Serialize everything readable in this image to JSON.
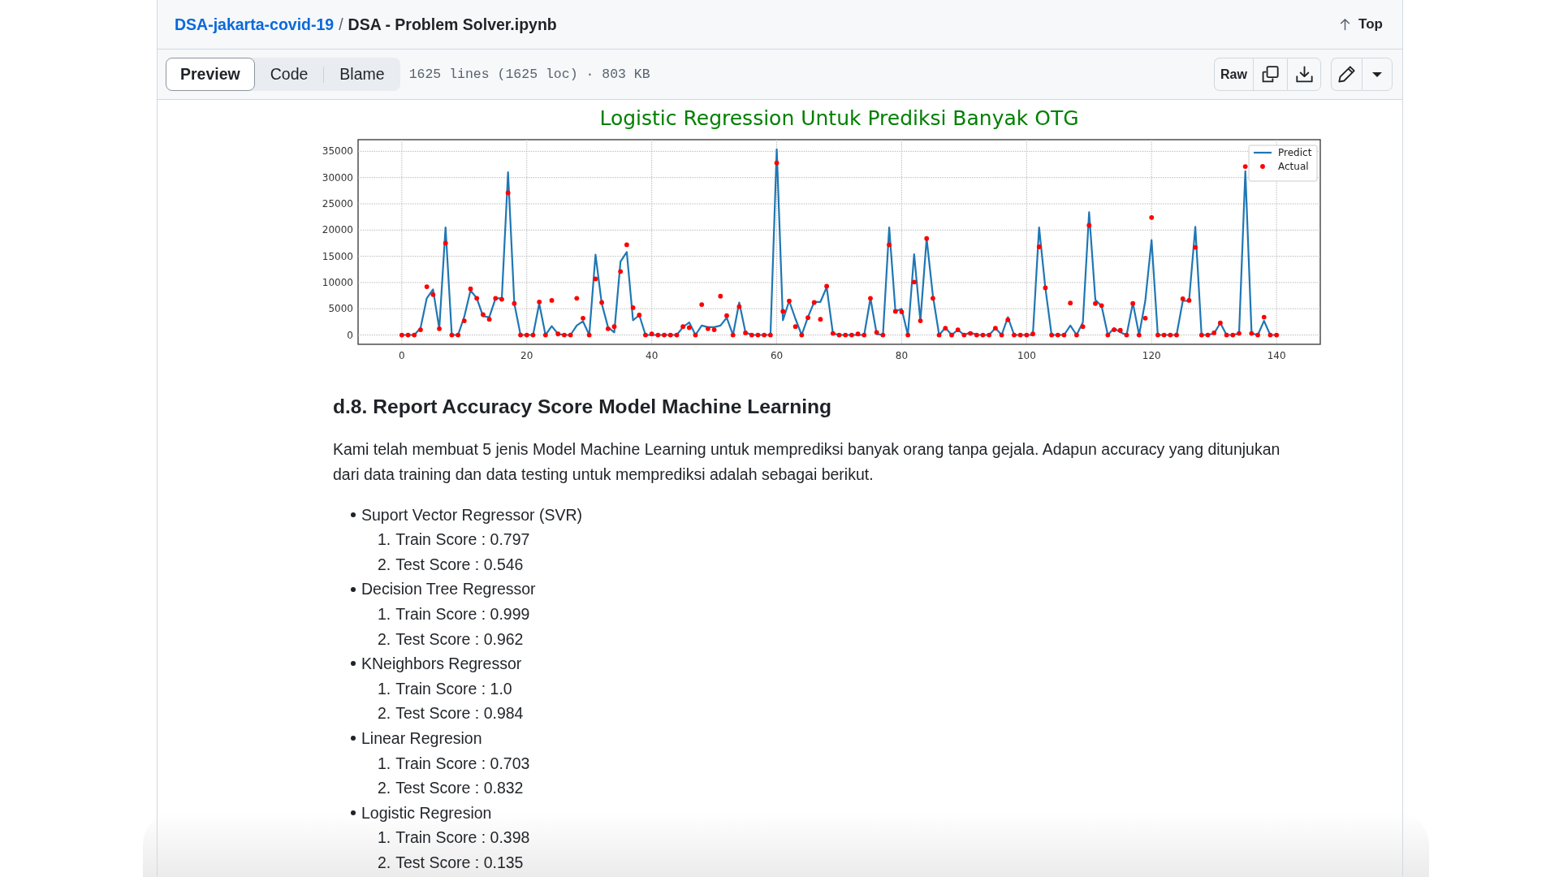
{
  "header": {
    "repo_link": "DSA-jakarta-covid-19",
    "separator": "/",
    "file_name": "DSA - Problem Solver.ipynb",
    "top_link": "Top"
  },
  "toolbar": {
    "tabs": [
      {
        "label": "Preview",
        "selected": true
      },
      {
        "label": "Code",
        "selected": false
      },
      {
        "label": "Blame",
        "selected": false
      }
    ],
    "file_info": "1625 lines (1625 loc) · 803 KB",
    "raw_button": "Raw"
  },
  "chart": {
    "chart_data": {
      "type": "line",
      "title": "Logistic Regression Untuk Prediksi Banyak OTG",
      "x": [
        0,
        1,
        2,
        3,
        4,
        5,
        6,
        7,
        8,
        9,
        10,
        11,
        12,
        13,
        14,
        15,
        16,
        17,
        18,
        19,
        20,
        21,
        22,
        23,
        24,
        25,
        26,
        27,
        28,
        29,
        30,
        31,
        32,
        33,
        34,
        35,
        36,
        37,
        38,
        39,
        40,
        41,
        42,
        43,
        44,
        45,
        46,
        47,
        48,
        49,
        50,
        51,
        52,
        53,
        54,
        55,
        56,
        57,
        58,
        59,
        60,
        61,
        62,
        63,
        64,
        65,
        66,
        67,
        68,
        69,
        70,
        71,
        72,
        73,
        74,
        75,
        76,
        77,
        78,
        79,
        80,
        81,
        82,
        83,
        84,
        85,
        86,
        87,
        88,
        89,
        90,
        91,
        92,
        93,
        94,
        95,
        96,
        97,
        98,
        99,
        100,
        101,
        102,
        103,
        104,
        105,
        106,
        107,
        108,
        109,
        110,
        111,
        112,
        113,
        114,
        115,
        116,
        117,
        118,
        119,
        120,
        121,
        122,
        123,
        124,
        125,
        126,
        127,
        128,
        129,
        130,
        131,
        132,
        133,
        134,
        135,
        136,
        137,
        138,
        139,
        140
      ],
      "series": [
        {
          "name": "Predict",
          "type": "line",
          "color": "#1f77b4",
          "values": [
            0,
            0,
            0,
            1300,
            7000,
            8700,
            1200,
            20500,
            0,
            0,
            3500,
            8500,
            7000,
            3600,
            3400,
            7000,
            7000,
            31000,
            6000,
            0,
            0,
            0,
            6000,
            0,
            1700,
            200,
            0,
            0,
            1800,
            2600,
            0,
            15300,
            6000,
            1500,
            500,
            14000,
            15800,
            2800,
            3800,
            0,
            0,
            0,
            0,
            0,
            0,
            1500,
            2400,
            0,
            1800,
            1500,
            1500,
            1800,
            3300,
            0,
            6200,
            500,
            0,
            0,
            0,
            0,
            35400,
            2800,
            6500,
            3100,
            0,
            3400,
            6300,
            6300,
            9100,
            300,
            0,
            0,
            0,
            0,
            0,
            7000,
            200,
            0,
            20500,
            4500,
            5000,
            0,
            15400,
            2700,
            18400,
            7500,
            0,
            1400,
            0,
            1000,
            0,
            500,
            0,
            0,
            0,
            1300,
            0,
            3400,
            0,
            0,
            0,
            0,
            20500,
            9000,
            0,
            0,
            0,
            1800,
            0,
            2400,
            23400,
            6700,
            5500,
            0,
            1300,
            500,
            0,
            6100,
            0,
            6500,
            18100,
            0,
            0,
            0,
            0,
            6500,
            6500,
            20600,
            0,
            0,
            300,
            2300,
            0,
            0,
            300,
            31200,
            300,
            0,
            2700,
            0,
            0
          ]
        },
        {
          "name": "Actual",
          "type": "scatter",
          "color": "#ff0000",
          "values": [
            0,
            0,
            0,
            1000,
            9200,
            7700,
            1200,
            17500,
            0,
            0,
            2700,
            8800,
            7000,
            3900,
            3000,
            7000,
            6800,
            27100,
            6000,
            0,
            0,
            0,
            6300,
            0,
            6600,
            200,
            0,
            0,
            7000,
            3200,
            0,
            10700,
            6200,
            1200,
            1600,
            12100,
            17200,
            5200,
            3800,
            0,
            200,
            0,
            0,
            0,
            0,
            1600,
            1400,
            0,
            5800,
            1200,
            1000,
            7400,
            3700,
            0,
            5400,
            400,
            0,
            0,
            0,
            0,
            32800,
            4500,
            6500,
            1600,
            0,
            3300,
            6200,
            3000,
            9300,
            300,
            0,
            0,
            0,
            200,
            0,
            7000,
            500,
            0,
            17200,
            4500,
            4400,
            0,
            10100,
            2700,
            18400,
            7000,
            0,
            1300,
            0,
            1000,
            0,
            300,
            0,
            0,
            0,
            1300,
            0,
            2900,
            0,
            0,
            0,
            200,
            16800,
            9000,
            0,
            0,
            0,
            6100,
            0,
            1600,
            20900,
            6000,
            5600,
            0,
            1000,
            900,
            0,
            6000,
            0,
            3200,
            22400,
            0,
            0,
            0,
            0,
            6900,
            6600,
            16700,
            0,
            0,
            400,
            2300,
            0,
            0,
            300,
            32100,
            300,
            0,
            3400,
            0,
            0
          ]
        }
      ],
      "xlim": [
        -7,
        147
      ],
      "ylim": [
        -1772,
        37222
      ],
      "xticks": [
        0,
        20,
        40,
        60,
        80,
        100,
        120,
        140
      ],
      "yticks": [
        0,
        5000,
        10000,
        15000,
        20000,
        25000,
        30000,
        35000
      ],
      "grid": true,
      "legend": "upper right"
    }
  },
  "section": {
    "heading": "d.8. Report Accuracy Score Model Machine Learning",
    "paragraph": "Kami telah membuat 5 jenis Model Machine Learning untuk memprediksi banyak orang tanpa gejala. Adapun accuracy yang ditunjukan dari data training dan data testing untuk memprediksi adalah sebagai berikut.",
    "models": [
      {
        "name": "Suport Vector Regressor (SVR)",
        "scores": [
          {
            "number": "1.",
            "text": "Train Score : 0.797"
          },
          {
            "number": "2.",
            "text": "Test Score : 0.546"
          }
        ]
      },
      {
        "name": "Decision Tree Regressor",
        "scores": [
          {
            "number": "1.",
            "text": "Train Score : 0.999"
          },
          {
            "number": "2.",
            "text": "Test Score : 0.962"
          }
        ]
      },
      {
        "name": "KNeighbors Regressor",
        "scores": [
          {
            "number": "1.",
            "text": "Train Score : 1.0"
          },
          {
            "number": "2.",
            "text": "Test Score : 0.984"
          }
        ]
      },
      {
        "name": "Linear Regresion",
        "scores": [
          {
            "number": "1.",
            "text": "Train Score : 0.703"
          },
          {
            "number": "2.",
            "text": "Test Score : 0.832"
          }
        ]
      },
      {
        "name": "Logistic Regresion",
        "scores": [
          {
            "number": "1.",
            "text": "Train Score : 0.398"
          },
          {
            "number": "2.",
            "text": "Test Score : 0.135"
          }
        ]
      }
    ]
  }
}
